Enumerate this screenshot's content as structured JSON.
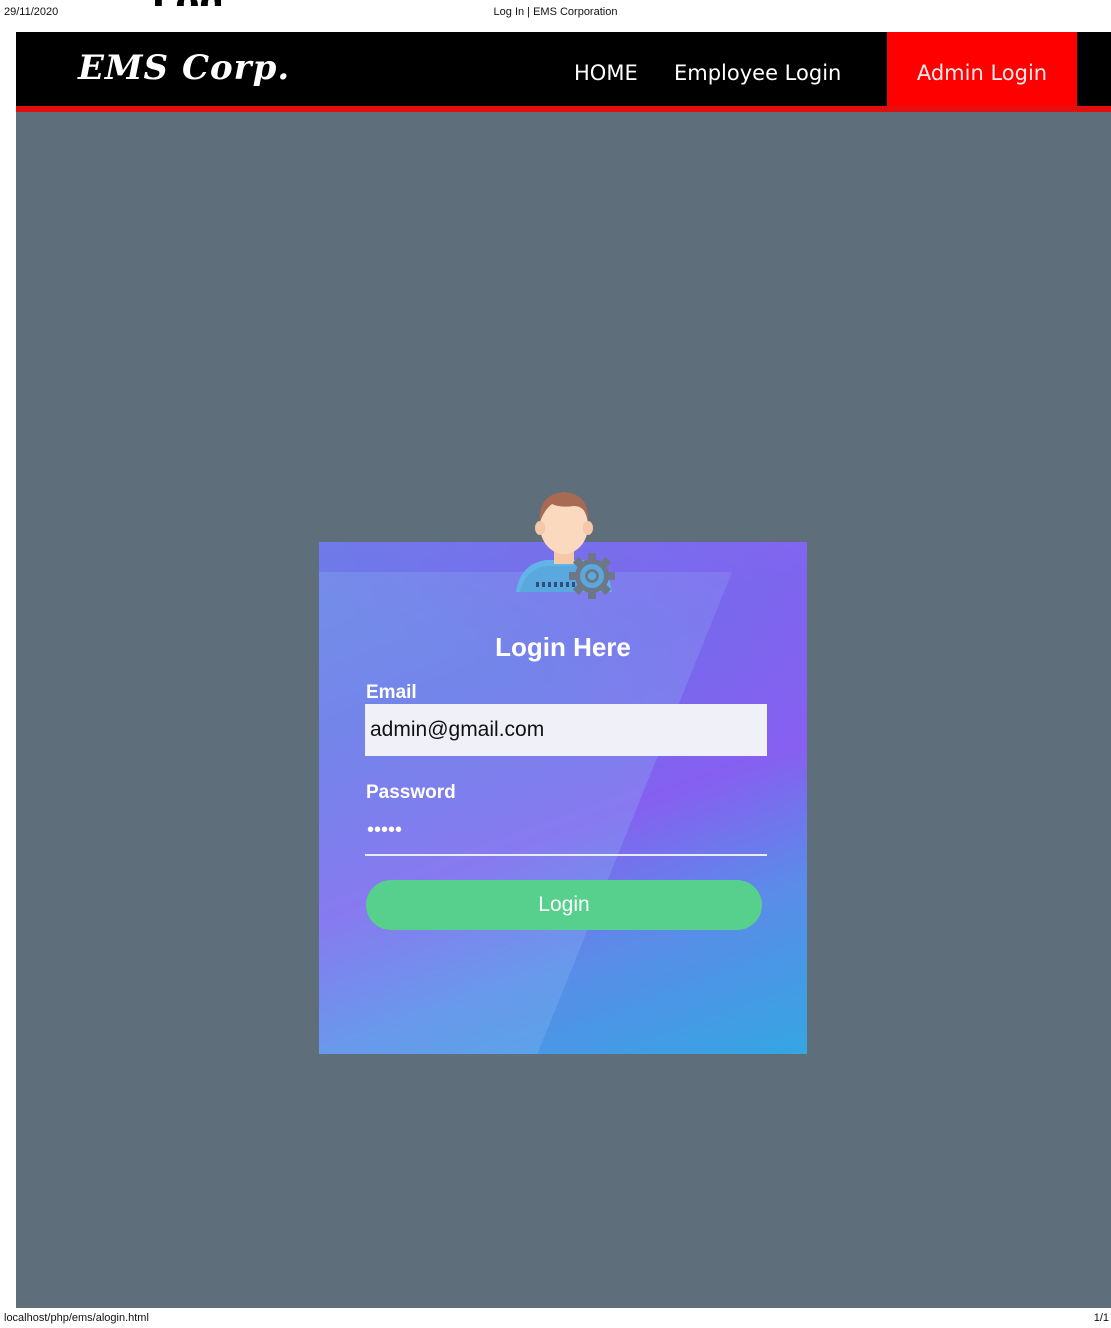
{
  "print": {
    "date": "29/11/2020",
    "title": "Log In | EMS Corporation",
    "url": "localhost/php/ems/alogin.html",
    "page_count": "1/1"
  },
  "navbar": {
    "brand": "EMS Corp.",
    "items": [
      {
        "label": "HOME"
      },
      {
        "label": "Employee Login"
      },
      {
        "label": "Admin Login",
        "active": true
      }
    ],
    "background": "#000000",
    "accent": "#ff0000"
  },
  "login": {
    "title": "Login Here",
    "email_label": "Email",
    "email_value": "admin@gmail.com",
    "password_label": "Password",
    "password_value": "•••••",
    "button_label": "Login",
    "avatar_icon": "admin-user-gear-icon",
    "button_color": "#56d08c"
  },
  "colors": {
    "page_background": "#5e6e7b"
  }
}
